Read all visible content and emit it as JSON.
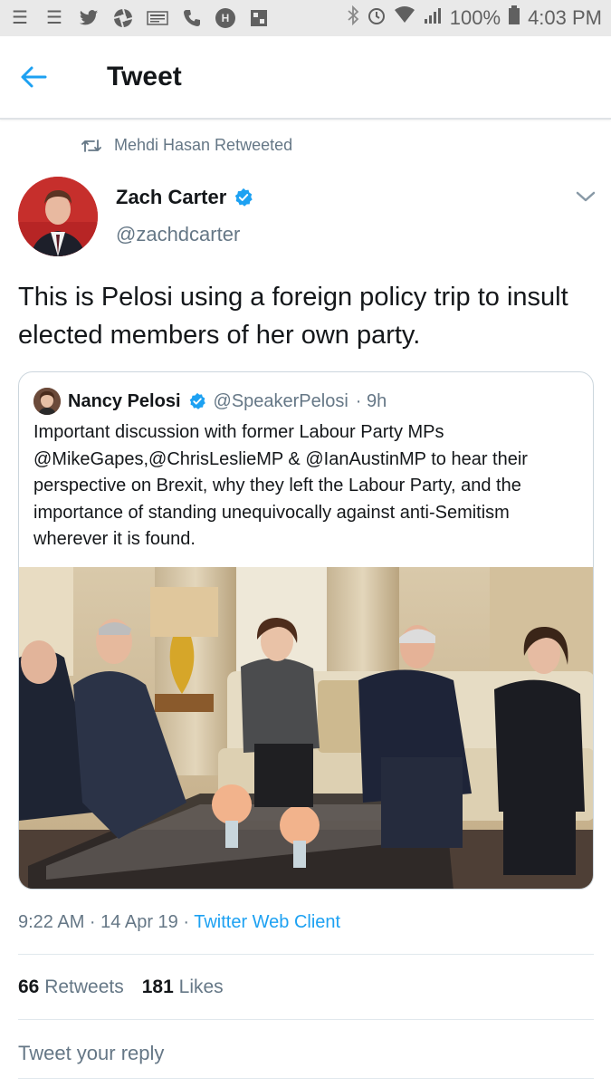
{
  "status_bar": {
    "left_icons": [
      "menu-icon",
      "menu-icon",
      "twitter-icon",
      "aperture-icon",
      "news-icon",
      "phone-icon",
      "h-icon",
      "grid-icon"
    ],
    "battery": "100%",
    "time": "4:03 PM"
  },
  "header": {
    "title": "Tweet"
  },
  "retweet_context": "Mehdi Hasan Retweeted",
  "author": {
    "name": "Zach Carter",
    "handle": "@zachdcarter"
  },
  "tweet_text": "This is Pelosi using a foreign policy trip to insult elected members of her own party.",
  "quoted": {
    "name": "Nancy Pelosi",
    "handle": "@SpeakerPelosi",
    "time": "· 9h",
    "text": "Important discussion with former Labour Party MPs @MikeGapes,@ChrisLeslieMP & @IanAustinMP to hear their perspective on Brexit, why they left the Labour Party, and the importance of standing unequivocally against anti-Semitism wherever it is found."
  },
  "meta": {
    "time_date": "9:22 AM · 14 Apr 19 · ",
    "client": "Twitter Web Client"
  },
  "stats": {
    "retweets_count": "66",
    "retweets_label": "Retweets",
    "likes_count": "181",
    "likes_label": "Likes"
  },
  "reply_placeholder": "Tweet your reply",
  "colors": {
    "accent": "#1da1f2",
    "muted": "#657786",
    "text": "#14171a",
    "border": "#ccd6dd"
  }
}
